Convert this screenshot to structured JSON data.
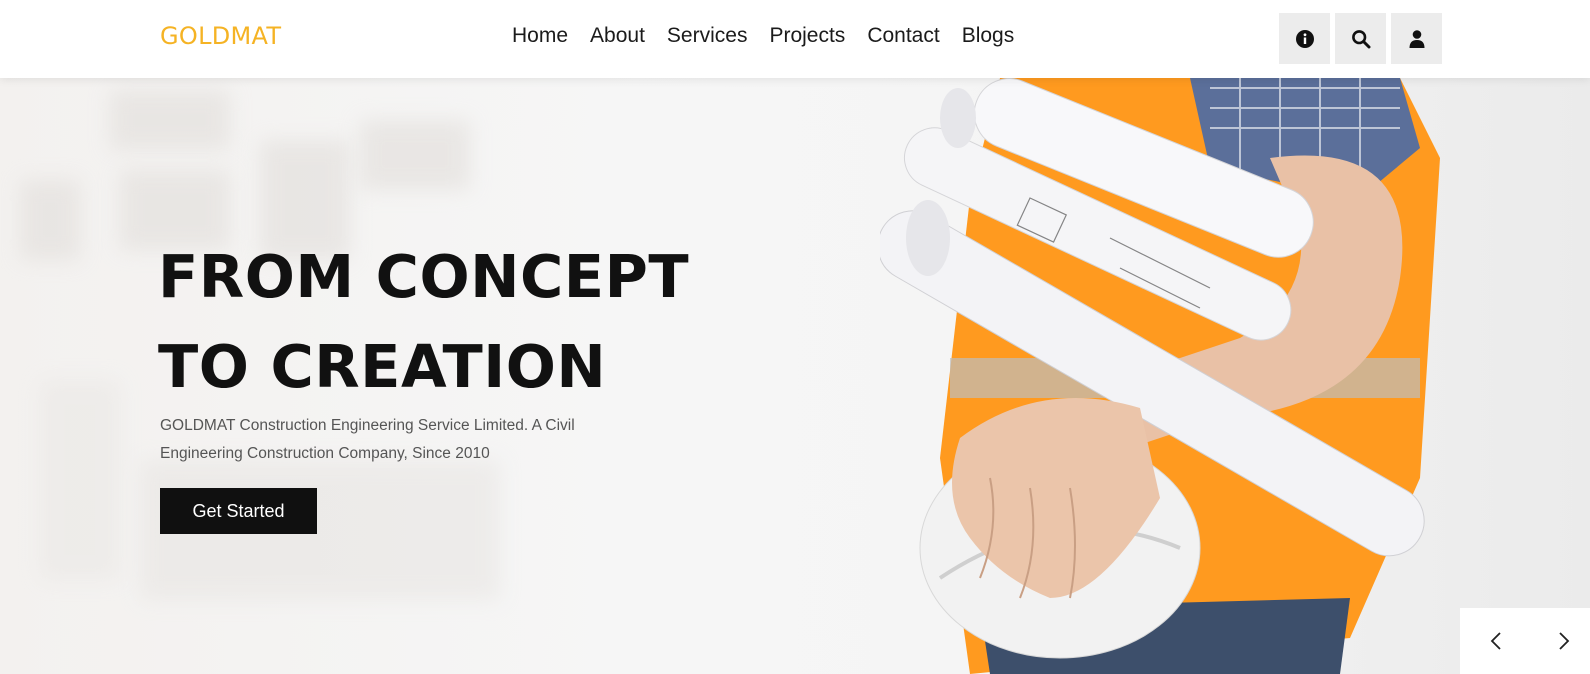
{
  "header": {
    "logo": "GOLDMAT",
    "nav": [
      "Home",
      "About",
      "Services",
      "Projects",
      "Contact",
      "Blogs"
    ],
    "icons": [
      "info-icon",
      "search-icon",
      "user-icon"
    ]
  },
  "hero": {
    "headline_line1": "FROM CONCEPT",
    "headline_line2": "TO CREATION",
    "subtitle": "GOLDMAT Construction Engineering Service Limited. A Civil Engineering Construction Company, Since 2010",
    "cta_label": "Get Started"
  },
  "slider": {
    "prev_icon": "chevron-left-icon",
    "next_icon": "chevron-right-icon"
  },
  "colors": {
    "brand": "#f5b324",
    "cta_bg": "#101010",
    "vest": "#ff9a1f"
  }
}
